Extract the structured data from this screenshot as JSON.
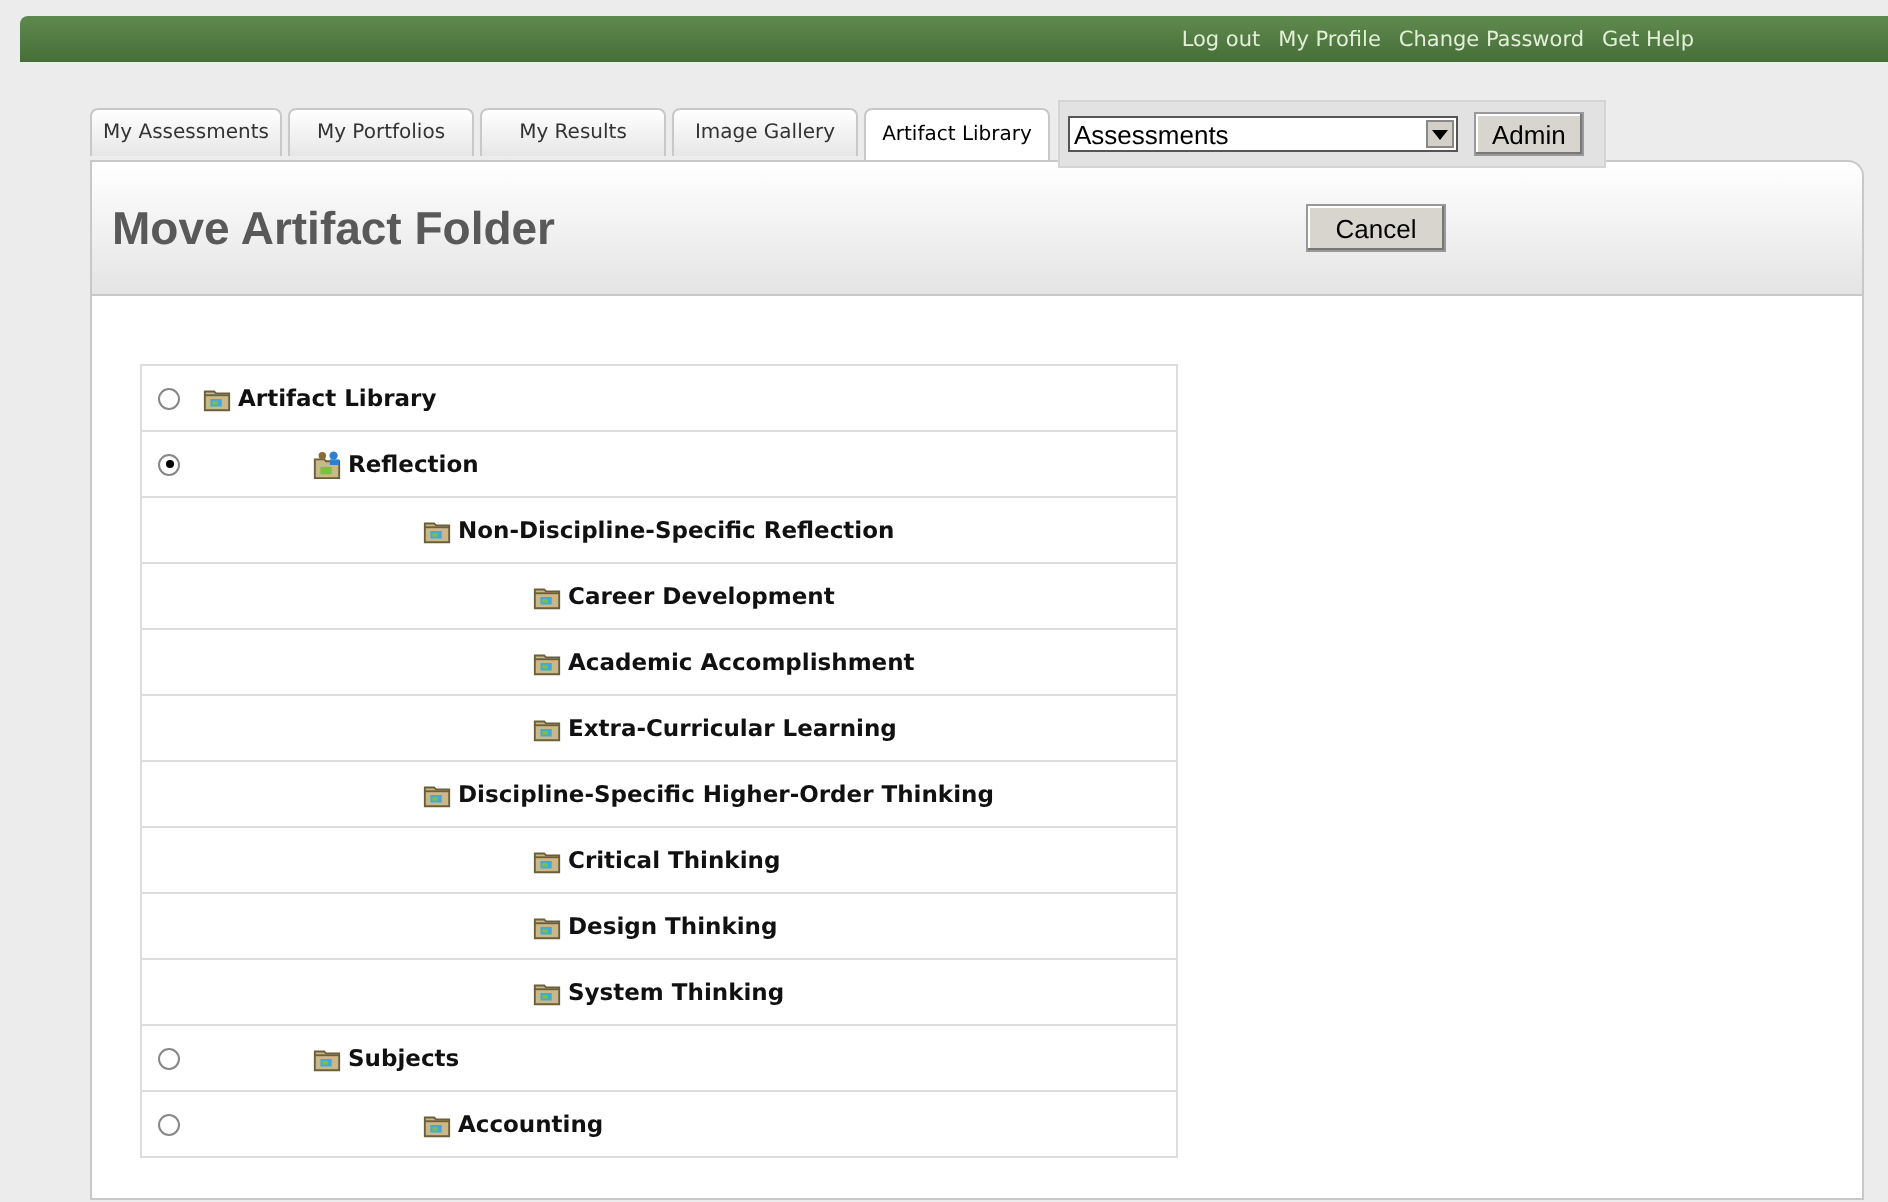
{
  "top_links": [
    "Log out",
    "My Profile",
    "Change Password",
    "Get Help"
  ],
  "tabs": [
    {
      "label": "My Assessments",
      "selected": false
    },
    {
      "label": "My Portfolios",
      "selected": false
    },
    {
      "label": "My Results",
      "selected": false
    },
    {
      "label": "Image Gallery",
      "selected": false
    },
    {
      "label": "Artifact Library",
      "selected": true
    }
  ],
  "select": {
    "value": "Assessments"
  },
  "admin_button": "Admin",
  "page_title": "Move Artifact Folder",
  "cancel_button": "Cancel",
  "folders": [
    {
      "label": "Artifact Library",
      "kind": "folder",
      "selectable": true,
      "selected": false,
      "children": [
        {
          "label": "Reflection",
          "kind": "shared-folder",
          "selectable": true,
          "selected": true,
          "children": [
            {
              "label": "Non-Discipline-Specific Reflection",
              "kind": "folder",
              "selectable": false,
              "children": [
                {
                  "label": "Career Development",
                  "kind": "folder",
                  "selectable": false
                },
                {
                  "label": "Academic Accomplishment",
                  "kind": "folder",
                  "selectable": false
                },
                {
                  "label": "Extra-Curricular Learning",
                  "kind": "folder",
                  "selectable": false
                }
              ]
            },
            {
              "label": "Discipline-Specific Higher-Order Thinking",
              "kind": "folder",
              "selectable": false,
              "children": [
                {
                  "label": "Critical Thinking",
                  "kind": "folder",
                  "selectable": false
                },
                {
                  "label": "Design Thinking",
                  "kind": "folder",
                  "selectable": false
                },
                {
                  "label": "System Thinking",
                  "kind": "folder",
                  "selectable": false
                }
              ]
            }
          ]
        },
        {
          "label": "Subjects",
          "kind": "folder",
          "selectable": true,
          "selected": false,
          "children": [
            {
              "label": "Accounting",
              "kind": "folder",
              "selectable": true,
              "selected": false
            }
          ]
        }
      ]
    }
  ]
}
